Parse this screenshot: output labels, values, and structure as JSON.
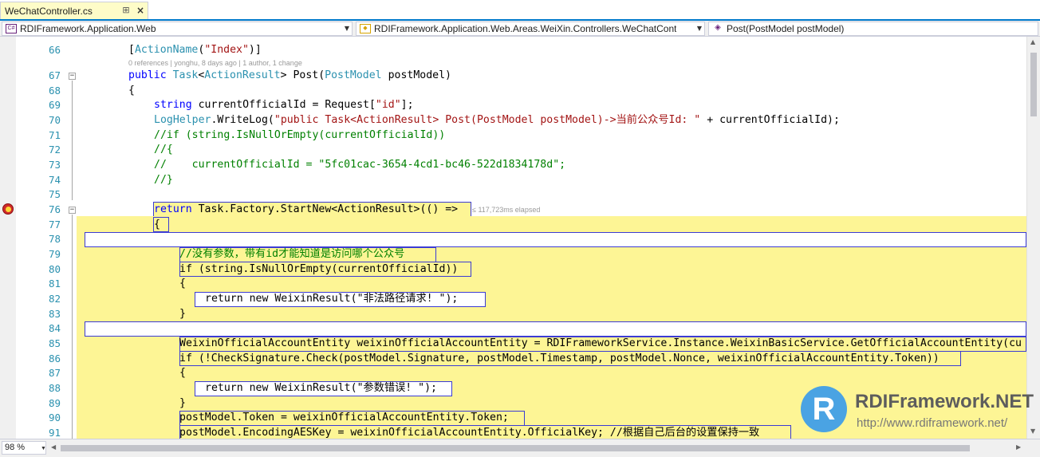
{
  "tab": {
    "title": "WeChatController.cs",
    "pin_icon": "pin-icon",
    "close_icon": "close-icon"
  },
  "navbar": {
    "project": "RDIFramework.Application.Web",
    "class": "RDIFramework.Application.Web.Areas.WeiXin.Controllers.WeChatCont",
    "member": "Post(PostModel postModel)"
  },
  "editor": {
    "line_numbers": [
      "66",
      "67",
      "68",
      "69",
      "70",
      "71",
      "72",
      "73",
      "74",
      "75",
      "76",
      "77",
      "78",
      "79",
      "80",
      "81",
      "82",
      "83",
      "84",
      "85",
      "86",
      "87",
      "88",
      "89",
      "90",
      "91"
    ],
    "code_lens": "0 references | yonghu, 8 days ago | 1 author, 1 change",
    "elapsed": "≤ 117,723ms elapsed",
    "lines": {
      "l66b": "[",
      "l66t": "ActionName",
      "l66c": "(",
      "l66s": "\"Index\"",
      "l66e": ")]",
      "l67k": "public ",
      "l67t": "Task",
      "l67a": "<",
      "l67t2": "ActionResult",
      "l67b": "> Post(",
      "l67t3": "PostModel",
      "l67c": " postModel)",
      "l68": "{",
      "l69k": "string",
      "l69a": " currentOfficialId = Request[",
      "l69s": "\"id\"",
      "l69b": "];",
      "l70t": "LogHelper",
      "l70a": ".WriteLog(",
      "l70s": "\"public Task<ActionResult> Post(PostModel postModel)->当前公众号Id: \"",
      "l70b": " + currentOfficialId);",
      "l71": "//if (string.IsNullOrEmpty(currentOfficialId))",
      "l72": "//{",
      "l73": "//    currentOfficialId = \"5fc01cac-3654-4cd1-bc46-522d1834178d\";",
      "l74": "//}",
      "l76k": "return",
      "l76a": " Task.Factory.StartNew<ActionResult>(() =>",
      "l77": "{",
      "l79": "//没有参数，带有id才能知道是访问哪个公众号",
      "l80": "if (string.IsNullOrEmpty(currentOfficialId))",
      "l81": "{",
      "l82a": "return new WeixinResult(",
      "l82s": "\"非法路径请求! \"",
      "l82b": ");",
      "l83": "}",
      "l85": "WeixinOfficialAccountEntity weixinOfficialAccountEntity = RDIFrameworkService.Instance.WeixinBasicService.GetOfficialAccountEntity(cu",
      "l86": "if (!CheckSignature.Check(postModel.Signature, postModel.Timestamp, postModel.Nonce, weixinOfficialAccountEntity.Token))",
      "l87": "{",
      "l88a": "return new WeixinResult(",
      "l88s": "\"参数错误! \"",
      "l88b": ");",
      "l89": "}",
      "l90": "postModel.Token = weixinOfficialAccountEntity.Token;",
      "l91": "postModel.EncodingAESKey = weixinOfficialAccountEntity.OfficialKey; //根据自己后台的设置保持一致"
    }
  },
  "logo": {
    "name": "RDIFramework.NET",
    "url": "http://www.rdiframework.net/",
    "mark": "R"
  },
  "status": {
    "zoom": "98 %"
  },
  "colors": {
    "keyword": "#0000ff",
    "type": "#2b91af",
    "string": "#a31515",
    "comment": "#008000",
    "highlight": "#fdf595",
    "accent": "#007acc"
  }
}
